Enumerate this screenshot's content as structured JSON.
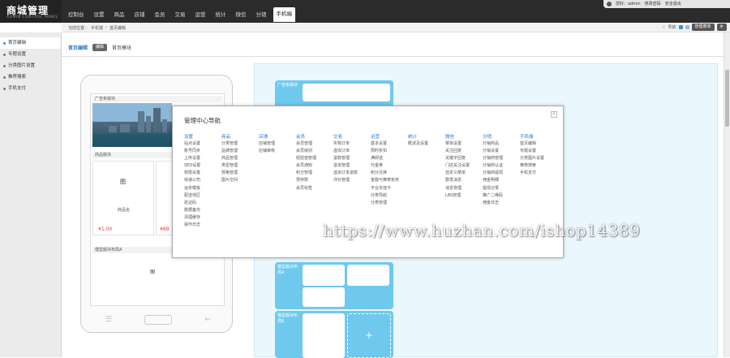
{
  "logo": {
    "title": "商城管理",
    "subtitle": "ADMIN CONTROL PANEL"
  },
  "nav": [
    "控制台",
    "设置",
    "商品",
    "店铺",
    "会员",
    "交易",
    "运营",
    "统计",
    "微信",
    "分销",
    "手机端"
  ],
  "user": {
    "greeting": "您好：admin",
    "links": [
      "修改密码",
      "安全退出"
    ]
  },
  "breadcrumb": {
    "prefix": "当前位置：",
    "items": [
      "手机端",
      "首页编辑"
    ]
  },
  "subtools": {
    "label": "导航",
    "button": "管理菜单",
    "gear": "设置"
  },
  "sidebar": [
    "首页编辑",
    "专题设置",
    "分类图片设置",
    "推荐搜索",
    "手机支付"
  ],
  "tabs": {
    "active": "首页编辑",
    "badge": "编辑",
    "other": "首页模块"
  },
  "phone": {
    "ad_title": "广告条版块",
    "goods_title": "商品版块",
    "price1": "¥1.00",
    "price2": "¥89",
    "goods_name": "商品名",
    "class_title": "模型版块布局A",
    "img_text": "图"
  },
  "editor": {
    "labels": [
      "广告条版块",
      "模型版块布局A",
      "模型版块布局B",
      "商品版块"
    ],
    "plus": "+"
  },
  "modal": {
    "title": "管理中心导航",
    "close": "×",
    "columns": [
      {
        "h": "设置",
        "items": [
          "站点设置",
          "账号同步",
          "上传设置",
          "SEO设置",
          "权限设置",
          "快递公司",
          "运单模板",
          "配送地区",
          "验证码",
          "数据备份",
          "清理缓存",
          "操作日志"
        ]
      },
      {
        "h": "商品",
        "items": [
          "分类管理",
          "品牌管理",
          "商品管理",
          "类型管理",
          "规格管理",
          "图片空间"
        ]
      },
      {
        "h": "店铺",
        "items": [
          "店铺管理",
          "店铺审核"
        ]
      },
      {
        "h": "会员",
        "items": [
          "会员管理",
          "会员级别",
          "经验值管理",
          "会员通知",
          "积分管理",
          "预存款",
          "会员标签"
        ]
      },
      {
        "h": "交易",
        "items": [
          "实物订单",
          "虚拟订单",
          "退款管理",
          "退货管理",
          "虚拟订单退款",
          "评价管理"
        ]
      },
      {
        "h": "运营",
        "items": [
          "基本设置",
          "限时折扣",
          "满即送",
          "代金券",
          "积分兑换",
          "金融与推荐有奖",
          "平台充值卡",
          "分类导航",
          "分类管理"
        ]
      },
      {
        "h": "统计",
        "items": [
          "概述及设置"
        ]
      },
      {
        "h": "微信",
        "items": [
          "菜单设置",
          "关注回复",
          "关键字回复",
          "门店关注设置",
          "自定义菜单",
          "群发消息",
          "消息管理",
          "LBS管理"
        ]
      },
      {
        "h": "分销",
        "items": [
          "分销商品",
          "分销设置",
          "分销商管理",
          "分销商认证",
          "分销商提现",
          "佣金明细",
          "提现记录",
          "推广二维码",
          "佣金日志"
        ]
      },
      {
        "h": "手机端",
        "items": [
          "首页编辑",
          "专题设置",
          "分类图片设置",
          "推荐搜索",
          "手机支付"
        ]
      }
    ]
  },
  "watermark": "https://www.huzhan.com/ishop14389"
}
